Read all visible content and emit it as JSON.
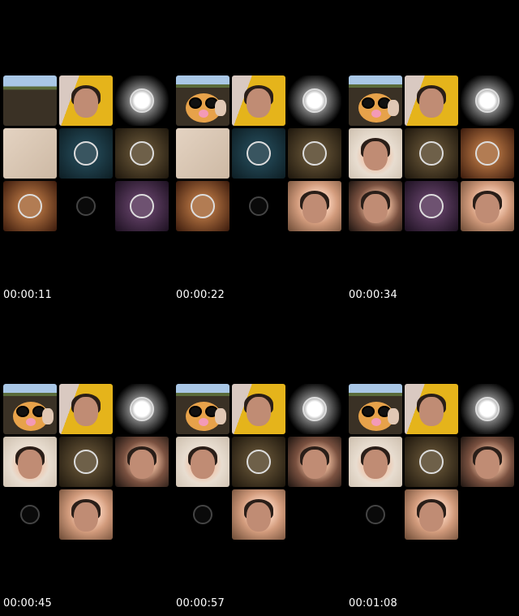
{
  "frames": [
    {
      "timestamp": "00:00:11",
      "tiles": [
        {
          "kind": "ground",
          "icon": "ground-scene"
        },
        {
          "kind": "yellow",
          "icon": "webcam-face"
        },
        {
          "kind": "glow",
          "icon": "avatar-ring"
        },
        {
          "kind": "beige",
          "icon": "blank-wall"
        },
        {
          "kind": "teal",
          "icon": "avatar-ring"
        },
        {
          "kind": "olive",
          "icon": "avatar-ring"
        },
        {
          "kind": "orange",
          "icon": "avatar-ring"
        },
        {
          "kind": "dark",
          "icon": "avatar-ring"
        },
        {
          "kind": "purple",
          "icon": "avatar-ring"
        }
      ]
    },
    {
      "timestamp": "00:00:22",
      "tiles": [
        {
          "kind": "cartoon",
          "icon": "cartoon-face"
        },
        {
          "kind": "yellow",
          "icon": "webcam-face"
        },
        {
          "kind": "glow",
          "icon": "avatar-ring"
        },
        {
          "kind": "beige",
          "icon": "blank-wall"
        },
        {
          "kind": "teal",
          "icon": "avatar-ring"
        },
        {
          "kind": "olive",
          "icon": "avatar-ring"
        },
        {
          "kind": "orange",
          "icon": "avatar-ring"
        },
        {
          "kind": "dark",
          "icon": "avatar-ring"
        },
        {
          "kind": "face-blonde",
          "icon": "webcam-face"
        }
      ]
    },
    {
      "timestamp": "00:00:34",
      "tiles": [
        {
          "kind": "cartoon",
          "icon": "cartoon-face"
        },
        {
          "kind": "yellow",
          "icon": "webcam-face"
        },
        {
          "kind": "glow",
          "icon": "avatar-ring"
        },
        {
          "kind": "face-cap",
          "icon": "webcam-face"
        },
        {
          "kind": "olive",
          "icon": "avatar-ring"
        },
        {
          "kind": "orange",
          "icon": "avatar-ring"
        },
        {
          "kind": "face-dark",
          "icon": "webcam-face"
        },
        {
          "kind": "purple",
          "icon": "avatar-ring"
        },
        {
          "kind": "face-blonde",
          "icon": "webcam-face"
        }
      ]
    },
    {
      "timestamp": "00:00:45",
      "tiles": [
        {
          "kind": "cartoon",
          "icon": "cartoon-face"
        },
        {
          "kind": "yellow",
          "icon": "webcam-face"
        },
        {
          "kind": "glow",
          "icon": "avatar-ring"
        },
        {
          "kind": "face-cap",
          "icon": "webcam-face"
        },
        {
          "kind": "olive",
          "icon": "avatar-ring"
        },
        {
          "kind": "face-dark",
          "icon": "webcam-face"
        },
        {
          "kind": "dark",
          "icon": "avatar-ring"
        },
        {
          "kind": "face-blonde",
          "icon": "webcam-face"
        }
      ]
    },
    {
      "timestamp": "00:00:57",
      "tiles": [
        {
          "kind": "cartoon",
          "icon": "cartoon-face"
        },
        {
          "kind": "yellow",
          "icon": "webcam-face"
        },
        {
          "kind": "glow",
          "icon": "avatar-ring"
        },
        {
          "kind": "face-cap",
          "icon": "webcam-face"
        },
        {
          "kind": "olive",
          "icon": "avatar-ring"
        },
        {
          "kind": "face-dark",
          "icon": "webcam-face"
        },
        {
          "kind": "dark",
          "icon": "avatar-ring"
        },
        {
          "kind": "face-blonde",
          "icon": "webcam-face"
        }
      ]
    },
    {
      "timestamp": "00:01:08",
      "tiles": [
        {
          "kind": "cartoon",
          "icon": "cartoon-face"
        },
        {
          "kind": "yellow",
          "icon": "webcam-face"
        },
        {
          "kind": "glow",
          "icon": "avatar-ring"
        },
        {
          "kind": "face-cap",
          "icon": "webcam-face"
        },
        {
          "kind": "olive",
          "icon": "avatar-ring"
        },
        {
          "kind": "face-dark",
          "icon": "webcam-face"
        },
        {
          "kind": "dark",
          "icon": "avatar-ring"
        },
        {
          "kind": "face-blonde",
          "icon": "webcam-face"
        }
      ]
    }
  ]
}
